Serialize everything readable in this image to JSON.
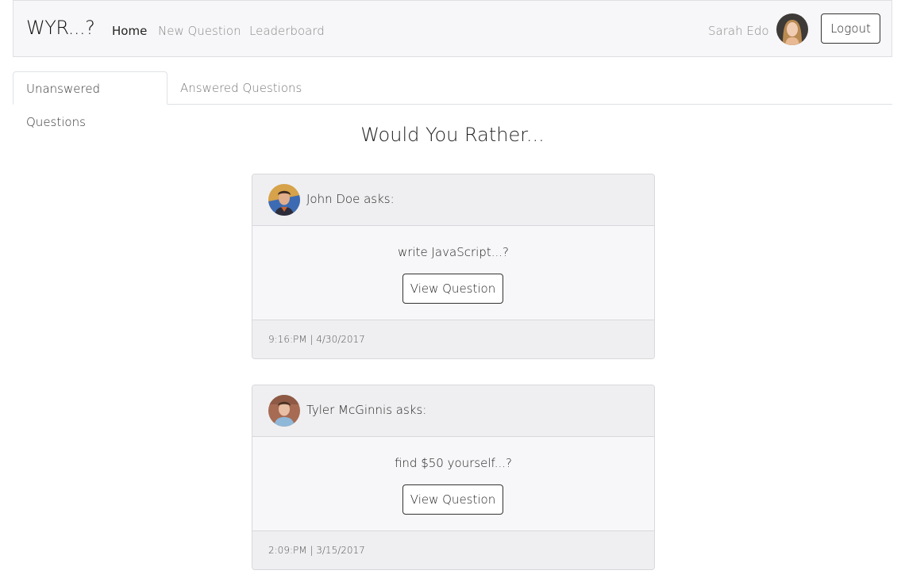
{
  "navbar": {
    "brand": "WYR...?",
    "links": [
      {
        "label": "Home",
        "active": true
      },
      {
        "label": "New Question",
        "active": false
      },
      {
        "label": "Leaderboard",
        "active": false
      }
    ],
    "user_name": "Sarah Edo",
    "avatar_icon": "user-avatar",
    "logout_label": "Logout"
  },
  "tabs": [
    {
      "label": "Unanswered Questions",
      "active": true
    },
    {
      "label": "Answered Questions",
      "active": false
    }
  ],
  "heading": "Would You Rather...",
  "questions": [
    {
      "asker": "John Doe asks:",
      "text": "write JavaScript...?",
      "button": "View Question",
      "timestamp": "9:16:PM | 4/30/2017",
      "avatar_icon": "john-doe-avatar"
    },
    {
      "asker": "Tyler McGinnis asks:",
      "text": "find $50 yourself...?",
      "button": "View Question",
      "timestamp": "2:09:PM | 3/15/2017",
      "avatar_icon": "tyler-mcginnis-avatar"
    }
  ],
  "colors": {
    "navbar_bg": "#f7f7f9",
    "card_bg": "#f7f7f9",
    "card_header_bg": "#efeff1",
    "border": "#dee2e6"
  }
}
